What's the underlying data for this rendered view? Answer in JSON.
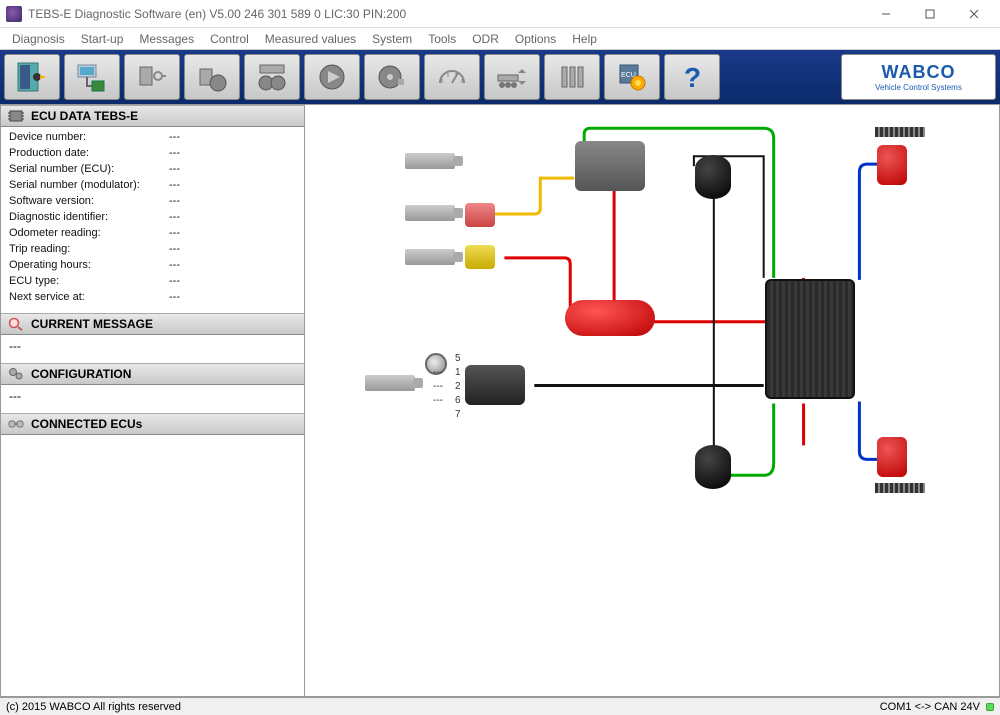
{
  "window": {
    "title": "TEBS-E Diagnostic Software (en) V5.00   246 301 589 0   LIC:30 PIN:200"
  },
  "menu": [
    "Diagnosis",
    "Start-up",
    "Messages",
    "Control",
    "Measured values",
    "System",
    "Tools",
    "ODR",
    "Options",
    "Help"
  ],
  "brand": {
    "name": "WABCO",
    "subtitle": "Vehicle Control Systems"
  },
  "sections": {
    "ecu_data": {
      "title": "ECU DATA TEBS-E",
      "rows": [
        {
          "label": "Device number:",
          "value": "---"
        },
        {
          "label": "Production date:",
          "value": "---"
        },
        {
          "label": "Serial number (ECU):",
          "value": "---"
        },
        {
          "label": "Serial number (modulator):",
          "value": "---"
        },
        {
          "label": "Software version:",
          "value": "---"
        },
        {
          "label": "Diagnostic identifier:",
          "value": "---"
        },
        {
          "label": "Odometer reading:",
          "value": "---"
        },
        {
          "label": "Trip reading:",
          "value": "---"
        },
        {
          "label": "Operating hours:",
          "value": "---"
        },
        {
          "label": "ECU type:",
          "value": "---"
        },
        {
          "label": "Next service at:",
          "value": "---"
        }
      ]
    },
    "current_message": {
      "title": "CURRENT MESSAGE",
      "value": "---"
    },
    "configuration": {
      "title": "CONFIGURATION",
      "value": "---"
    },
    "connected_ecus": {
      "title": "CONNECTED ECUs",
      "value": ""
    }
  },
  "diagram": {
    "port_labels": [
      "5",
      "1",
      "2",
      "6",
      "7"
    ],
    "port_values": [
      "",
      "---",
      "---",
      "---",
      ""
    ]
  },
  "status": {
    "copyright": "(c) 2015 WABCO All rights reserved",
    "conn": "COM1 <-> CAN 24V"
  }
}
